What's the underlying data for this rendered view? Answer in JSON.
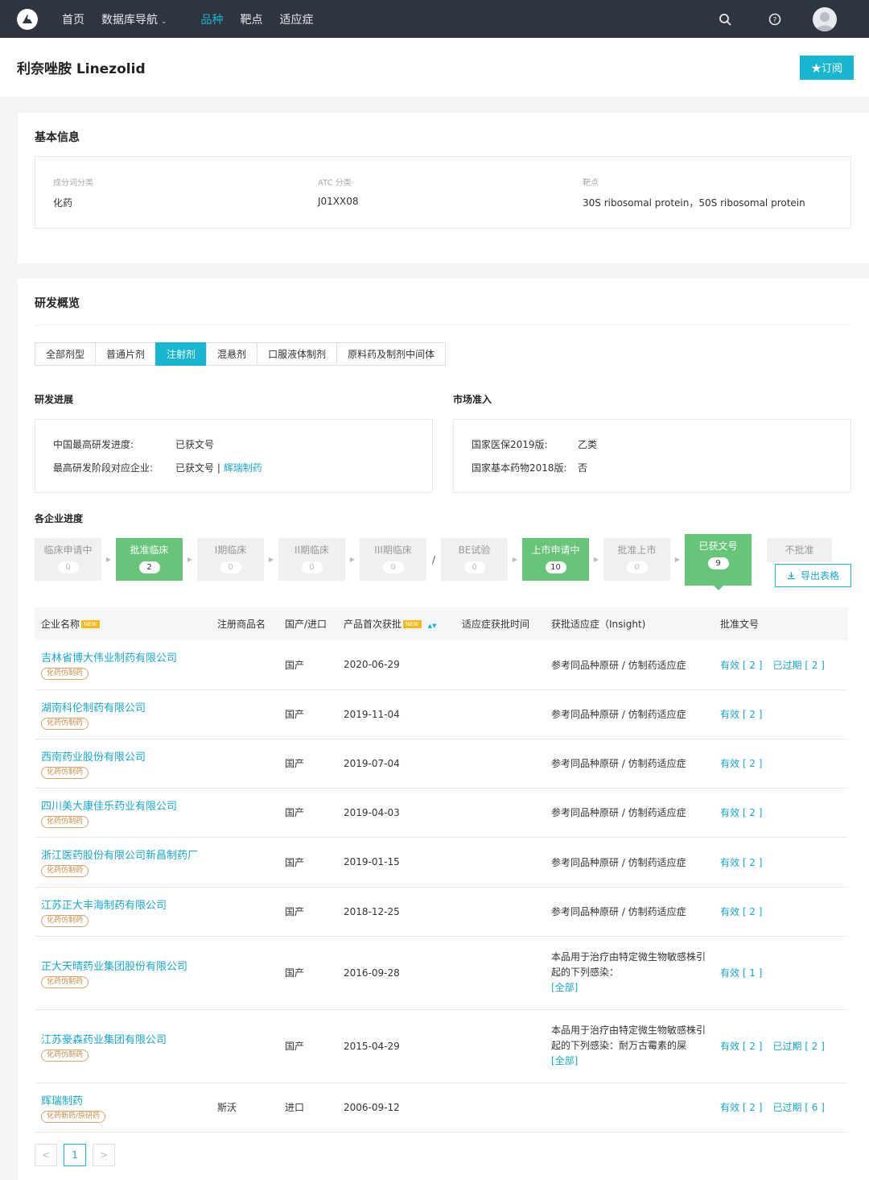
{
  "nav": {
    "items": [
      "首页",
      "数据库导航",
      "品种",
      "靶点",
      "适应症"
    ]
  },
  "page": {
    "title": "利奈唑胺 Linezolid",
    "subscribe_label": "★订阅"
  },
  "basic": {
    "title": "基本信息",
    "fields": [
      {
        "label": "成分词分类",
        "value": "化药"
      },
      {
        "label": "ATC 分类",
        "value": "J01XX08"
      },
      {
        "label": "靶点",
        "value": "30S ribosomal protein，50S ribosomal protein"
      }
    ]
  },
  "overview": {
    "title": "研发概览",
    "tabs": [
      "全部剂型",
      "普通片剂",
      "注射剂",
      "混悬剂",
      "口服液体制剂",
      "原料药及制剂中间体"
    ],
    "active_tab": "注射剂",
    "progress": {
      "title": "研发进展",
      "rows": [
        {
          "key": "中国最高研发进度:",
          "value": "已获文号"
        },
        {
          "key": "最高研发阶段对应企业:",
          "value": "已获文号 |",
          "link": "辉瑞制药"
        }
      ]
    },
    "market": {
      "title": "市场准入",
      "rows": [
        {
          "key": "国家医保2019版:",
          "value": "乙类"
        },
        {
          "key": "国家基本药物2018版:",
          "value": "否"
        }
      ]
    }
  },
  "company_progress": {
    "title": "各企业进度",
    "stages": [
      {
        "label": "临床申请中",
        "count": "0"
      },
      {
        "label": "批准临床",
        "count": "2"
      },
      {
        "label": "I期临床",
        "count": "0"
      },
      {
        "label": "II期临床",
        "count": "0"
      },
      {
        "label": "III期临床",
        "count": "0"
      },
      {
        "label": "BE试验",
        "count": "0"
      },
      {
        "label": "上市申请中",
        "count": "10"
      },
      {
        "label": "批准上市",
        "count": "0"
      },
      {
        "label": "已获文号",
        "count": "9"
      },
      {
        "label": "不批准"
      }
    ],
    "separator": "/",
    "export_label": "导出表格"
  },
  "table": {
    "headers": [
      "企业名称",
      "注册商品名",
      "国产/进口",
      "产品首次获批",
      "适应症获批时间",
      "获批适应症（Insight)",
      "批准文号"
    ],
    "new_tag": "NEW",
    "rows": [
      {
        "company": "吉林省博大伟业制药有限公司",
        "badge": "化药仿制药",
        "brand": "",
        "origin": "国产",
        "date": "2020-06-29",
        "indication": "参考同品种原研 / 仿制药适应症",
        "valid": "有效 [ 2 ]",
        "expired": "已过期 [ 2 ]"
      },
      {
        "company": "湖南科伦制药有限公司",
        "badge": "化药仿制药",
        "brand": "",
        "origin": "国产",
        "date": "2019-11-04",
        "indication": "参考同品种原研 / 仿制药适应症",
        "valid": "有效 [ 2 ]",
        "expired": ""
      },
      {
        "company": "西南药业股份有限公司",
        "badge": "化药仿制药",
        "brand": "",
        "origin": "国产",
        "date": "2019-07-04",
        "indication": "参考同品种原研 / 仿制药适应症",
        "valid": "有效 [ 2 ]",
        "expired": ""
      },
      {
        "company": "四川美大康佳乐药业有限公司",
        "badge": "化药仿制药",
        "brand": "",
        "origin": "国产",
        "date": "2019-04-03",
        "indication": "参考同品种原研 / 仿制药适应症",
        "valid": "有效 [ 2 ]",
        "expired": ""
      },
      {
        "company": "浙江医药股份有限公司新昌制药厂",
        "badge": "化药仿制药",
        "brand": "",
        "origin": "国产",
        "date": "2019-01-15",
        "indication": "参考同品种原研 / 仿制药适应症",
        "valid": "有效 [ 2 ]",
        "expired": ""
      },
      {
        "company": "江苏正大丰海制药有限公司",
        "badge": "化药仿制药",
        "brand": "",
        "origin": "国产",
        "date": "2018-12-25",
        "indication": "参考同品种原研 / 仿制药适应症",
        "valid": "有效 [ 2 ]",
        "expired": ""
      },
      {
        "company": "正大天晴药业集团股份有限公司",
        "badge": "化药仿制药",
        "brand": "",
        "origin": "国产",
        "date": "2016-09-28",
        "indication": "本品用于治疗由特定微生物敏感株引起的下列感染：",
        "more": "[全部]",
        "valid": "有效 [ 1 ]",
        "expired": ""
      },
      {
        "company": "江苏豪森药业集团有限公司",
        "badge": "化药仿制药",
        "brand": "",
        "origin": "国产",
        "date": "2015-04-29",
        "indication": "本品用于治疗由特定微生物敏感株引起的下列感染：耐万古霉素的屎",
        "more": "[全部]",
        "valid": "有效 [ 2 ]",
        "expired": "已过期 [ 2 ]"
      },
      {
        "company": "辉瑞制药",
        "badge": "化药新药/原研药",
        "brand": "斯沃",
        "origin": "进口",
        "date": "2006-09-12",
        "indication": "",
        "valid": "有效 [ 2 ]",
        "expired": "已过期 [ 6 ]"
      }
    ]
  },
  "pager": {
    "prev": "<",
    "current": "1",
    "next": ">"
  },
  "colors": {
    "accent": "#19b6d2",
    "green": "#67c57a",
    "topbar": "#2e3440",
    "badge": "#d9a46c"
  }
}
